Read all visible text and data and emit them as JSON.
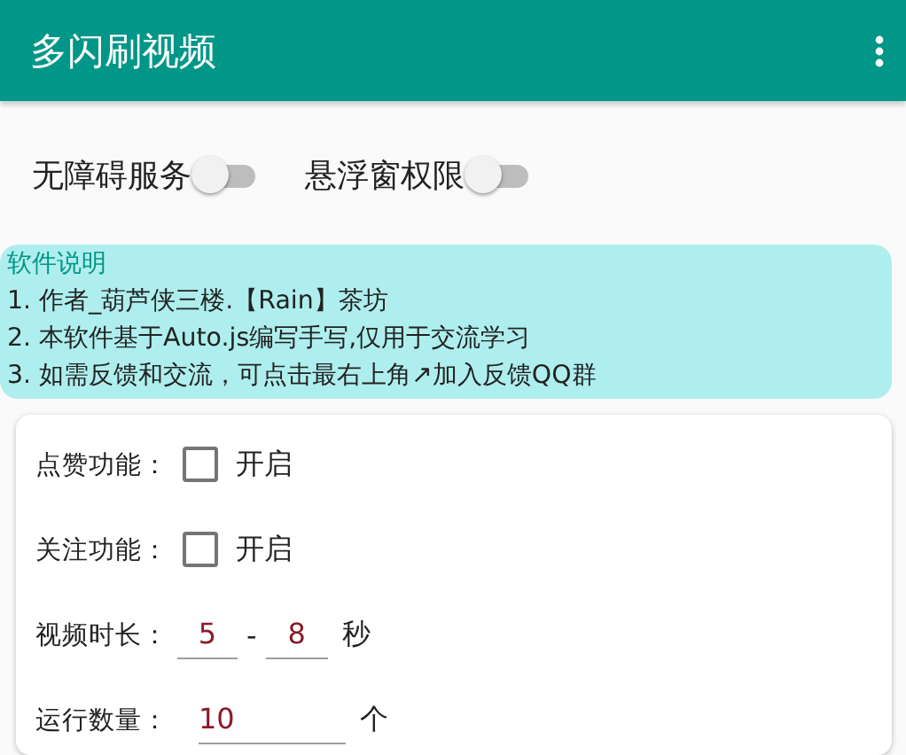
{
  "app_bar": {
    "title": "多闪刷视频"
  },
  "switches": [
    {
      "label": "无障碍服务",
      "on": false
    },
    {
      "label": "悬浮窗权限",
      "on": false
    }
  ],
  "info": {
    "title": "软件说明",
    "lines": [
      "1. 作者_葫芦侠三楼.【Rain】茶坊",
      "2. 本软件基于Auto.js编写手写,仅用于交流学习",
      "3. 如需反馈和交流，可点击最右上角↗加入反馈QQ群"
    ]
  },
  "form": [
    {
      "kind": "checkbox",
      "label": "点赞功能：",
      "option": "开启",
      "checked": false
    },
    {
      "kind": "checkbox",
      "label": "关注功能：",
      "option": "开启",
      "checked": false
    },
    {
      "kind": "range",
      "label": "视频时长：",
      "min": "5",
      "separator": "-",
      "max": "8",
      "unit": "秒"
    },
    {
      "kind": "number",
      "label": "运行数量：",
      "value": "10",
      "unit": "个"
    }
  ]
}
